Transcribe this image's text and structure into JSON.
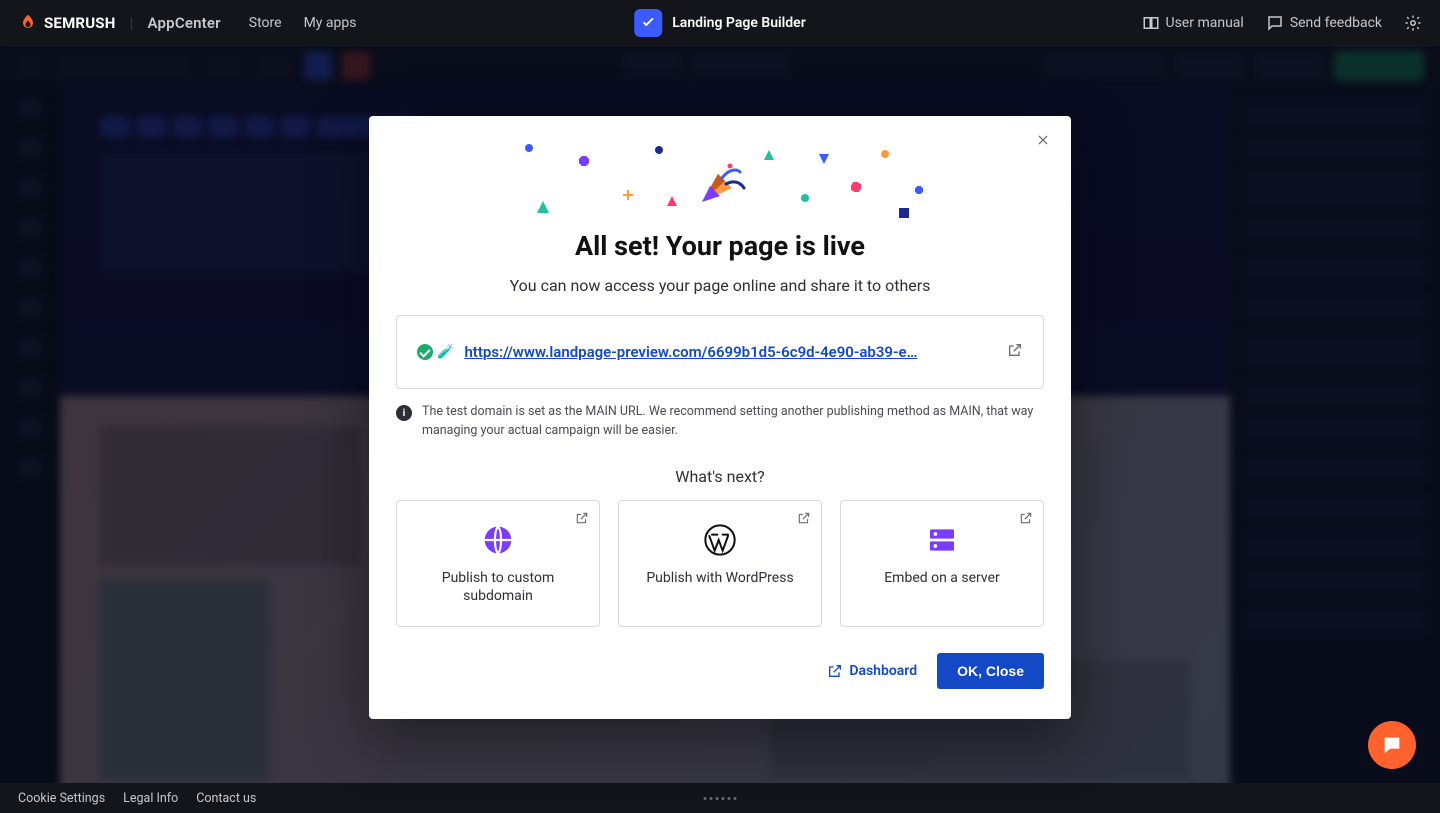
{
  "header": {
    "brand_main": "SEMRUSH",
    "brand_sub": "AppCenter",
    "nav_store": "Store",
    "nav_myapps": "My apps",
    "app_title": "Landing Page Builder",
    "user_manual": "User manual",
    "send_feedback": "Send feedback"
  },
  "modal": {
    "heading": "All set! Your page is live",
    "lead": "You can now access your page online and share it to others",
    "url": "https://www.landpage-preview.com/6699b1d5-6c9d-4e90-ab39-e…",
    "info_text": "The test domain is set as the MAIN URL. We recommend setting another publishing method as MAIN, that way managing your actual campaign will be easier.",
    "whats_next": "What's next?",
    "card1": "Publish to custom subdomain",
    "card2": "Publish with WordPress",
    "card3": "Embed on a server",
    "dashboard": "Dashboard",
    "ok_close": "OK, Close",
    "flask_emoji": "🧪"
  },
  "footer": {
    "cookie": "Cookie Settings",
    "legal": "Legal Info",
    "contact": "Contact us"
  }
}
